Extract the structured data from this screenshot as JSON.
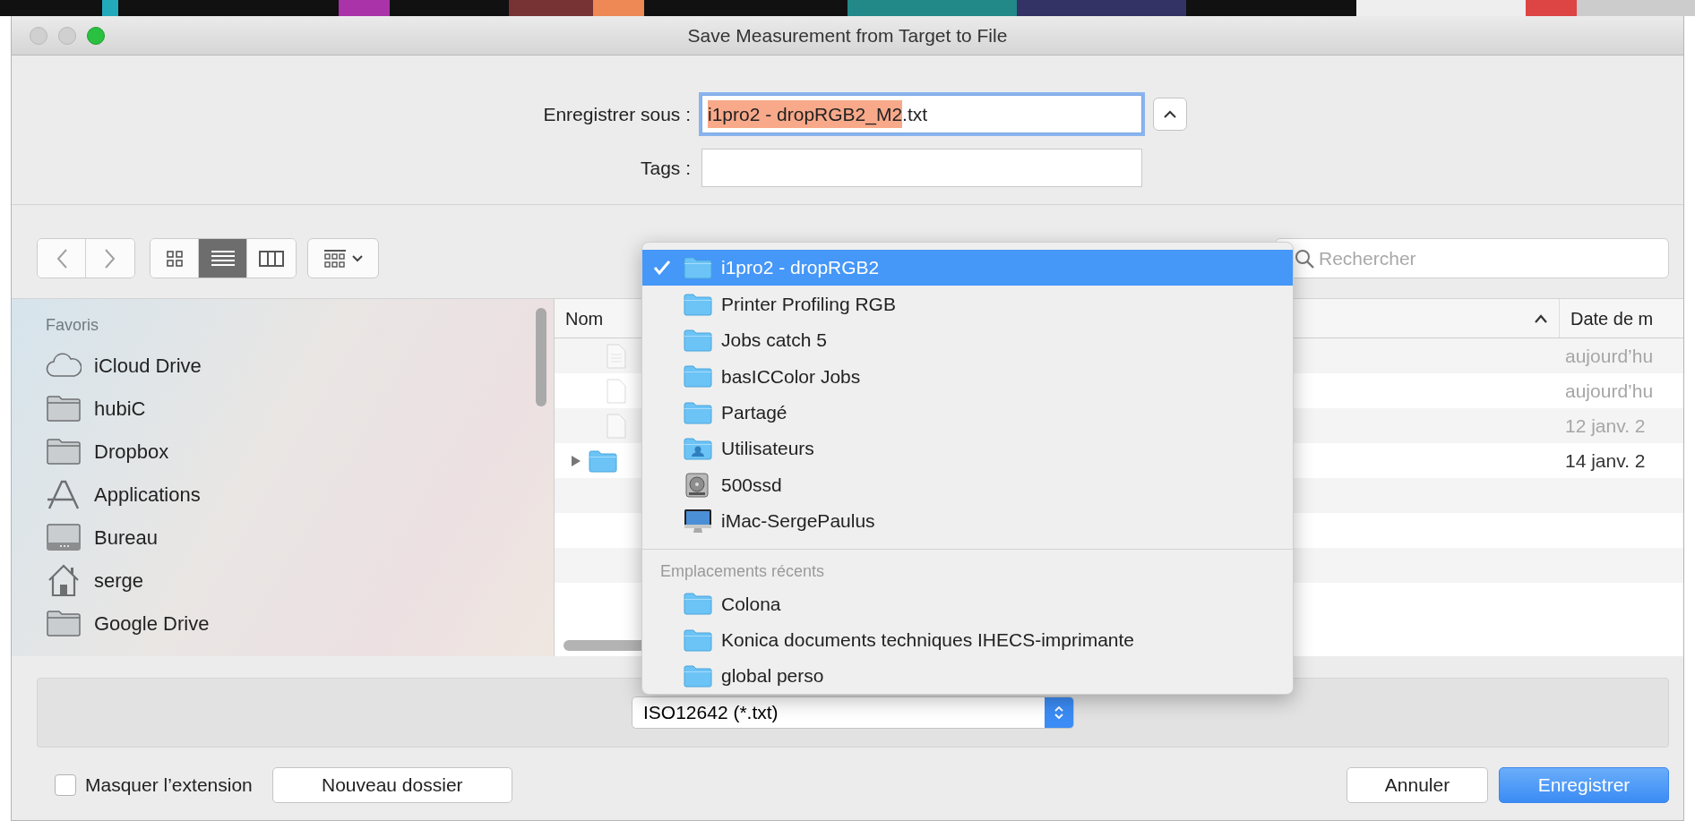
{
  "window": {
    "title": "Save Measurement from Target to File"
  },
  "save_as": {
    "label": "Enregistrer sous :",
    "value_selected": "i1pro2 - dropRGB2_M2",
    "value_rest": ".txt",
    "expanded": true
  },
  "tags": {
    "label": "Tags :"
  },
  "view_modes": [
    {
      "kind": "icons",
      "selected": false
    },
    {
      "kind": "list",
      "selected": true
    },
    {
      "kind": "columns",
      "selected": false
    }
  ],
  "search": {
    "placeholder": "Rechercher"
  },
  "sidebar": {
    "heading": "Favoris",
    "items": [
      {
        "label": "iCloud Drive",
        "kind": "cloud"
      },
      {
        "label": "hubiC",
        "kind": "folder"
      },
      {
        "label": "Dropbox",
        "kind": "folder"
      },
      {
        "label": "Applications",
        "kind": "apps"
      },
      {
        "label": "Bureau",
        "kind": "desktop"
      },
      {
        "label": "serge",
        "kind": "home"
      },
      {
        "label": "Google Drive",
        "kind": "folder"
      }
    ]
  },
  "file_list": {
    "columns": [
      {
        "label": "Nom",
        "sorted": true
      },
      {
        "label": "Date de m",
        "sorted": false
      }
    ],
    "rows": [
      {
        "kind": "text",
        "date": "aujourd’hu",
        "disabled": true
      },
      {
        "kind": "blank",
        "date": "aujourd’hu",
        "disabled": true
      },
      {
        "kind": "blank",
        "date": "12 janv. 2",
        "disabled": true
      },
      {
        "kind": "folder",
        "date": "14 janv. 2",
        "disabled": false
      }
    ]
  },
  "location_menu": {
    "items": [
      {
        "label": "i1pro2 - dropRGB2",
        "kind": "folder",
        "selected": true
      },
      {
        "label": "Printer Profiling RGB",
        "kind": "folder",
        "selected": false
      },
      {
        "label": "Jobs catch 5",
        "kind": "folder",
        "selected": false
      },
      {
        "label": "basICColor Jobs",
        "kind": "folder",
        "selected": false
      },
      {
        "label": "Partagé",
        "kind": "folder",
        "selected": false
      },
      {
        "label": "Utilisateurs",
        "kind": "users",
        "selected": false
      },
      {
        "label": "500ssd",
        "kind": "drive",
        "selected": false
      },
      {
        "label": "iMac-SergePaulus",
        "kind": "computer",
        "selected": false
      }
    ],
    "recent_heading": "Emplacements récents",
    "recent_items": [
      {
        "label": "Colona",
        "kind": "folder",
        "selected": false
      },
      {
        "label": "Konica documents techniques IHECS-imprimante",
        "kind": "folder",
        "selected": false
      },
      {
        "label": "global perso",
        "kind": "folder",
        "selected": false
      }
    ]
  },
  "format": {
    "value": "ISO12642 (*.txt)"
  },
  "hide_extension": {
    "label": "Masquer l’extension",
    "checked": false
  },
  "buttons": [
    {
      "label": "Nouveau dossier",
      "kind": "normal"
    },
    {
      "label": "Annuler",
      "kind": "normal"
    },
    {
      "label": "Enregistrer",
      "kind": "default"
    }
  ]
}
